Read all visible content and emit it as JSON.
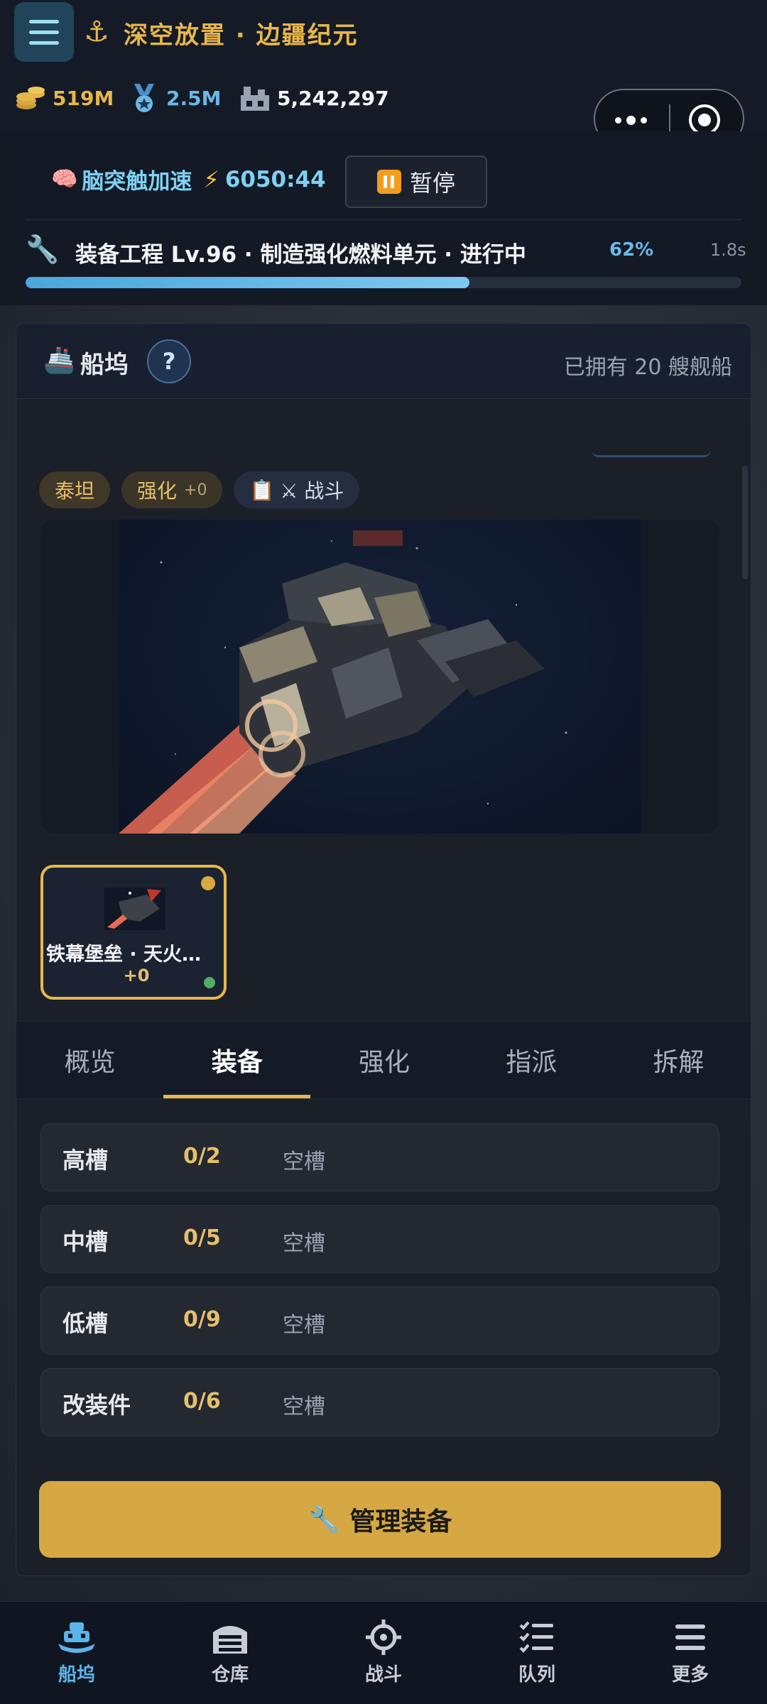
{
  "header": {
    "title": "深空放置 · 边疆纪元",
    "resources": [
      {
        "icon": "coins-icon",
        "value": "519M",
        "color": "#e8b64a"
      },
      {
        "icon": "medal-icon",
        "value": "2.5M",
        "color": "#6cb7e6"
      },
      {
        "icon": "factory-icon",
        "value": "5,242,297",
        "color": "#f2f4f7"
      }
    ]
  },
  "status": {
    "boost_label": "脑突触加速",
    "boost_timer": "6050:44",
    "pause_label": "暂停",
    "task_text": "装备工程 Lv.96 · 制造强化燃料单元 · 进行中",
    "task_percent": "62%",
    "task_progress": 0.62,
    "task_time": "1.8s"
  },
  "dock": {
    "title": "船坞",
    "help": "?",
    "owned_text": "已拥有 20 艘舰船",
    "tags": {
      "class": "泰坦",
      "enhance": "强化",
      "enhance_value": "+0",
      "role": "⚔ 战斗"
    },
    "selected_ship": {
      "name": "铁幕堡垒 · 天火…",
      "level": "+0"
    },
    "tabs": [
      "概览",
      "装备",
      "强化",
      "指派",
      "拆解"
    ],
    "active_tab": "装备",
    "slots": [
      {
        "name": "高槽",
        "count": "0/2",
        "state": "空槽"
      },
      {
        "name": "中槽",
        "count": "0/5",
        "state": "空槽"
      },
      {
        "name": "低槽",
        "count": "0/9",
        "state": "空槽"
      },
      {
        "name": "改装件",
        "count": "0/6",
        "state": "空槽"
      }
    ],
    "manage_button": "管理装备"
  },
  "nav": [
    {
      "label": "船坞",
      "icon": "ship-icon"
    },
    {
      "label": "仓库",
      "icon": "warehouse-icon"
    },
    {
      "label": "战斗",
      "icon": "crosshair-icon"
    },
    {
      "label": "队列",
      "icon": "checklist-icon"
    },
    {
      "label": "更多",
      "icon": "menu-icon"
    }
  ],
  "colors": {
    "accent": "#e7b84a",
    "active_nav": "#5bb4ea",
    "progress": "#4aa6dc"
  }
}
